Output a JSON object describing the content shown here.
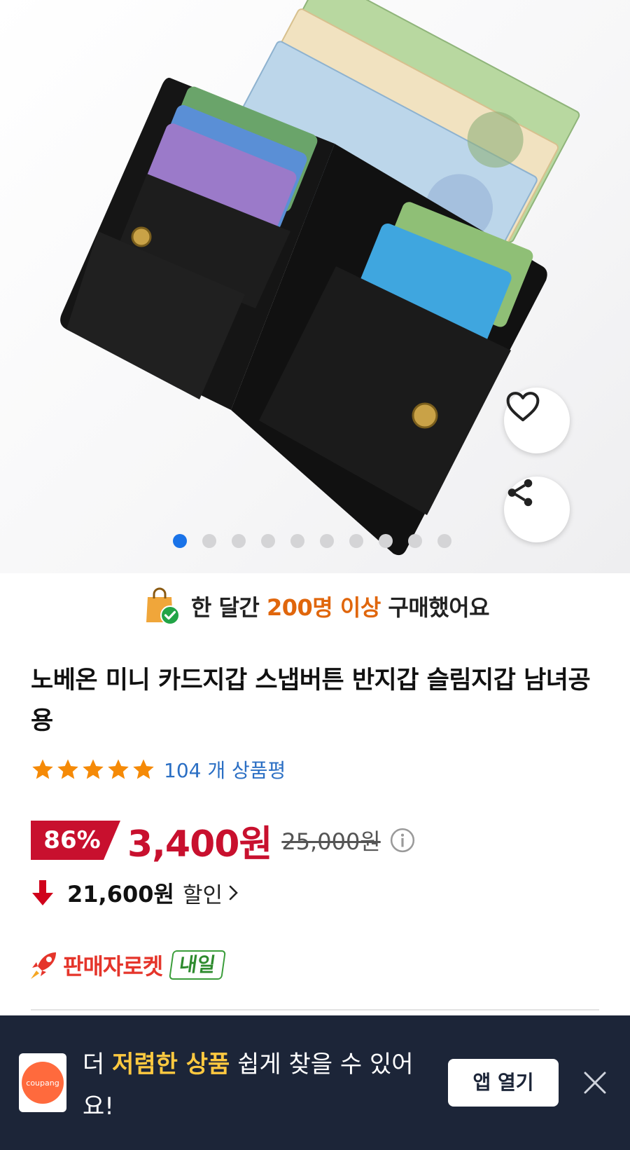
{
  "hero": {
    "image_alt": "",
    "carousel_total": 10,
    "carousel_active": 1
  },
  "social_proof": {
    "prefix": "한 달간 ",
    "highlight": "200명 이상",
    "suffix": " 구매했어요"
  },
  "product": {
    "title": "노베온 미니 카드지갑 스냅버튼 반지갑 슬림지갑 남녀공용",
    "rating_stars": 5,
    "review_count_label": "104 개 상품평"
  },
  "price": {
    "discount_rate": "86%",
    "current": "3,400원",
    "original": "25,000원",
    "saving_amount": "21,600원",
    "saving_label": "할인"
  },
  "delivery": {
    "rocket_label": "판매자로켓",
    "eta_badge": "내일"
  },
  "banner": {
    "logo_text": "coupang",
    "text_prefix": "더 ",
    "text_highlight": "저렴한 상품",
    "text_suffix": " 쉽게 찾을 수 있어요!",
    "open_button": "앱 열기"
  },
  "colors": {
    "accent_blue": "#1a73e8",
    "price_red": "#c8102e",
    "highlight_orange": "#e0660c",
    "banner_bg": "#1c2538",
    "banner_highlight": "#ffc940",
    "rocket_green": "#3a9d3a",
    "star_orange": "#f58a07"
  },
  "icons": [
    "heart-icon",
    "share-icon",
    "shopping-bag-check-icon",
    "star-icon",
    "info-icon",
    "down-arrow-icon",
    "chevron-right-icon",
    "rocket-icon",
    "close-icon"
  ]
}
